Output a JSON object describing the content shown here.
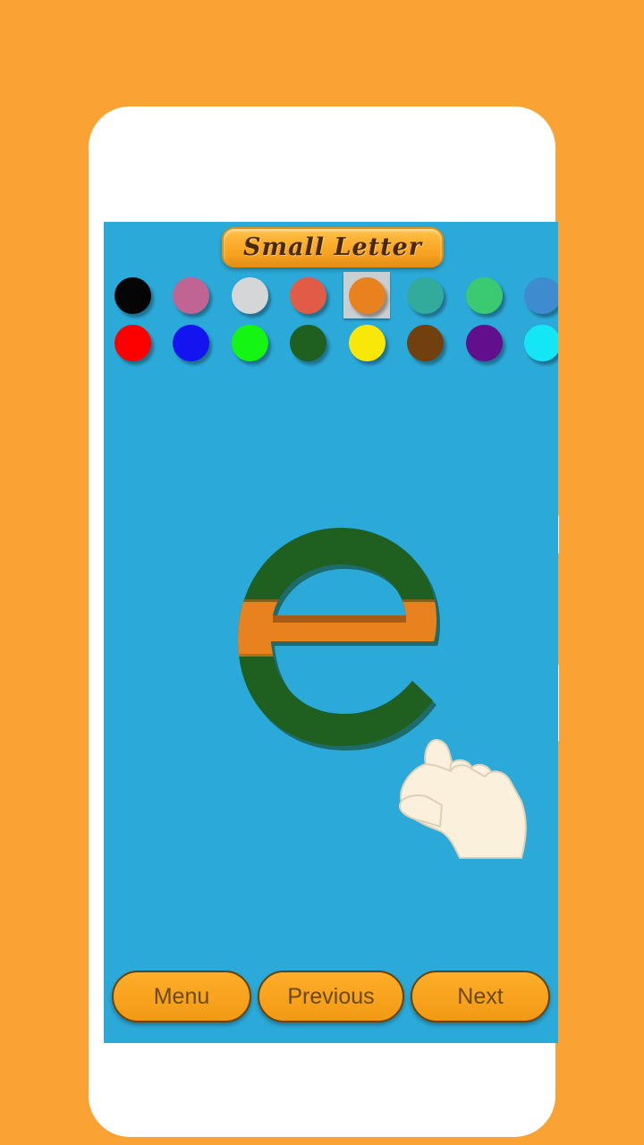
{
  "app": {
    "background_color": "#fba235",
    "phone_frame_color": "#ffffff",
    "screen_color": "#2ba9d8"
  },
  "header": {
    "title": "Small Letter",
    "pill_color": "#f9a71f",
    "text_color": "#4a2a06"
  },
  "palette": {
    "selected_index": 4,
    "selection_highlight_color": "#c9ced1",
    "rows": [
      {
        "swatches": [
          {
            "name": "black",
            "color": "#050505"
          },
          {
            "name": "pink",
            "color": "#c06494"
          },
          {
            "name": "light-gray",
            "color": "#d4d6d8"
          },
          {
            "name": "salmon-red",
            "color": "#e15b46"
          },
          {
            "name": "orange",
            "color": "#e8821f"
          },
          {
            "name": "teal",
            "color": "#33ab9c"
          },
          {
            "name": "spring-green",
            "color": "#3bca72"
          },
          {
            "name": "steel-blue",
            "color": "#3f8bd0"
          }
        ]
      },
      {
        "swatches": [
          {
            "name": "red",
            "color": "#fc0000"
          },
          {
            "name": "blue",
            "color": "#1414f0"
          },
          {
            "name": "lime-green",
            "color": "#14f514"
          },
          {
            "name": "dark-green",
            "color": "#1f6020"
          },
          {
            "name": "yellow",
            "color": "#fae70a"
          },
          {
            "name": "brown",
            "color": "#72400f"
          },
          {
            "name": "purple",
            "color": "#610f8c"
          },
          {
            "name": "cyan",
            "color": "#15e6f5"
          }
        ]
      }
    ]
  },
  "canvas": {
    "letter": "e",
    "letter_case": "small",
    "outline_color": "#0d3a10",
    "fill_regions": [
      {
        "name": "letter-body",
        "color": "#1f6020"
      },
      {
        "name": "letter-stripe",
        "color": "#e8821f"
      }
    ],
    "cursor": {
      "name": "pointing-hand",
      "skin_color": "#faf0dc"
    }
  },
  "nav": {
    "buttons": [
      {
        "name": "menu",
        "label": "Menu"
      },
      {
        "name": "previous",
        "label": "Previous"
      },
      {
        "name": "next",
        "label": "Next"
      }
    ],
    "button_color": "#f9a21d",
    "button_text_color": "#6b4a12"
  }
}
